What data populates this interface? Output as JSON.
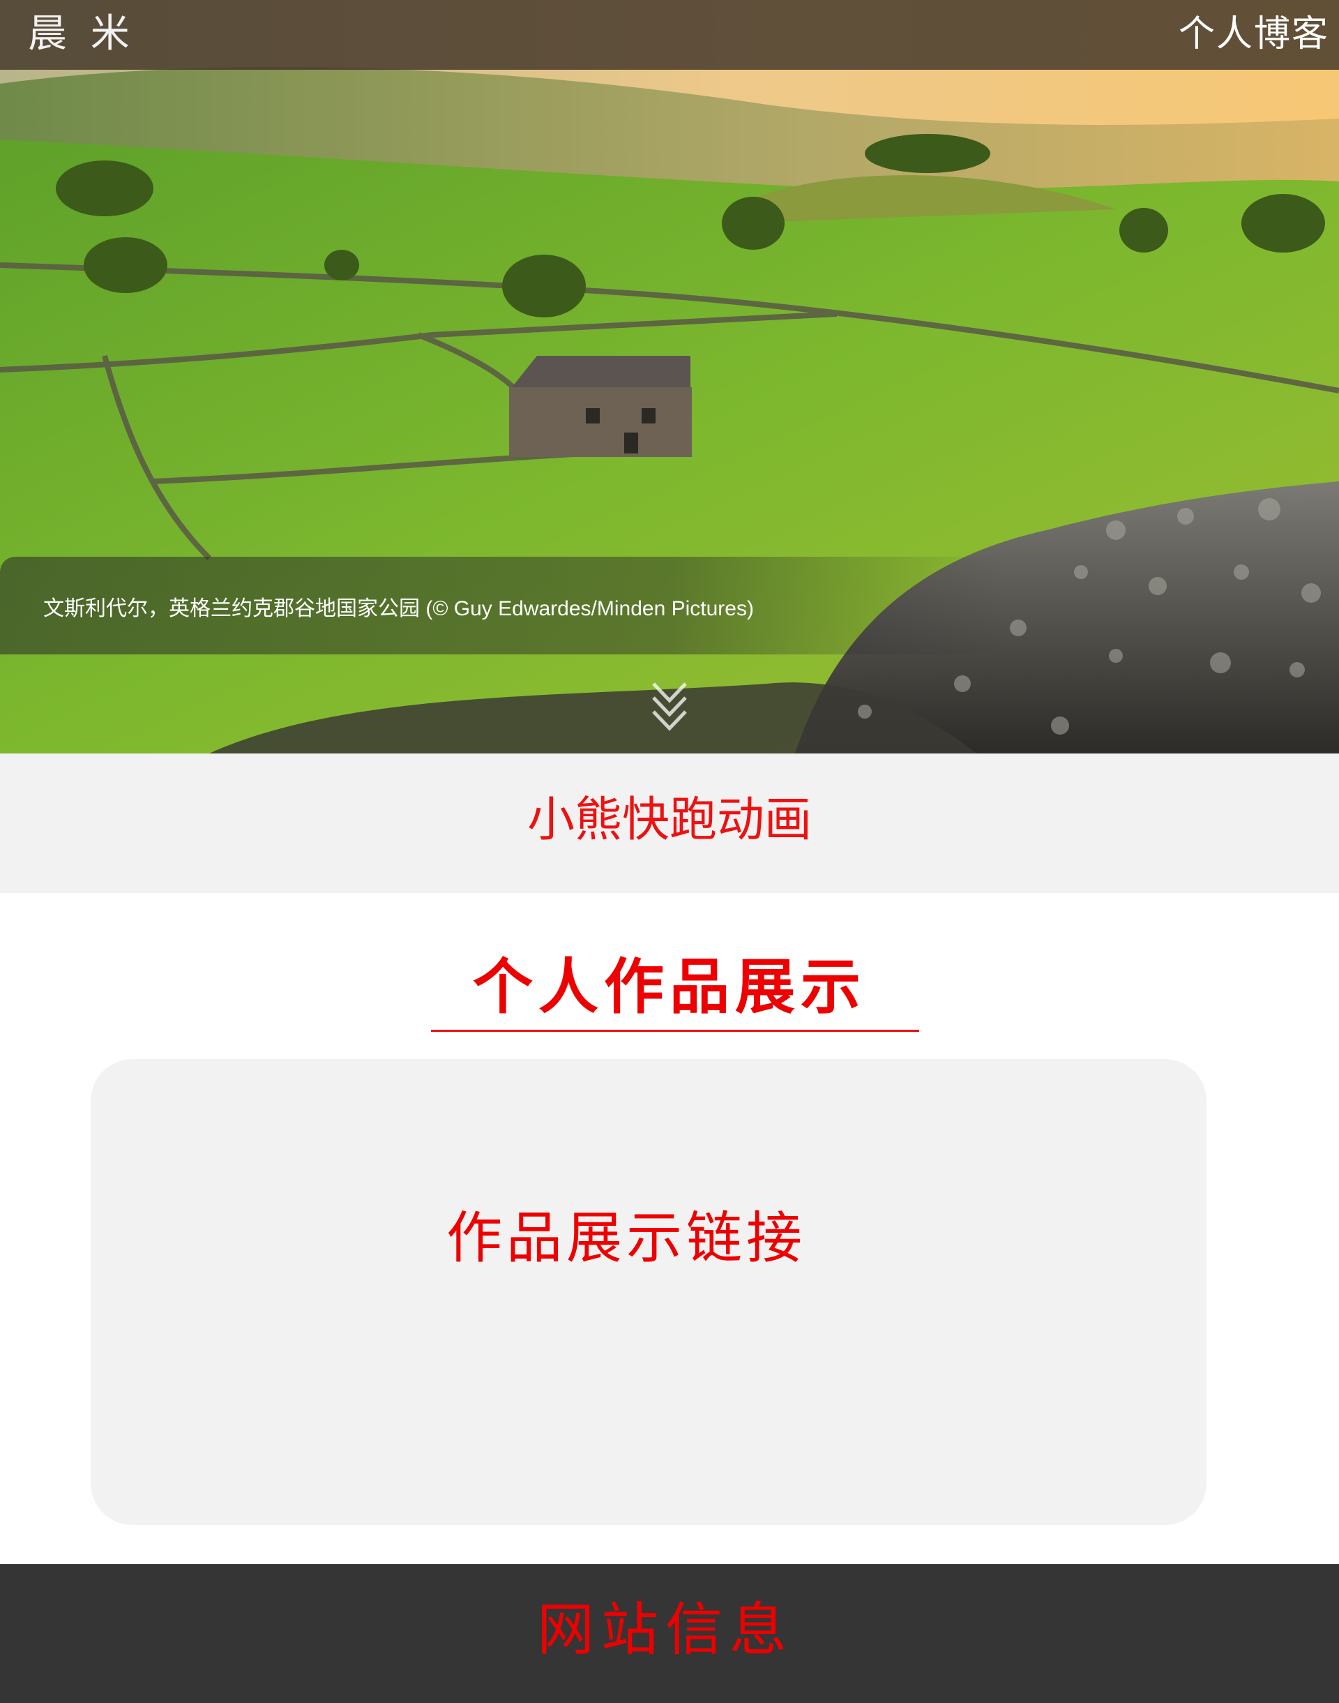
{
  "header": {
    "brand": "晨 米",
    "blog_link": "个人博客"
  },
  "hero": {
    "caption": "文斯利代尔，英格兰约克郡谷地国家公园 (© Guy Edwardes/Minden Pictures)",
    "scroll_icon": "double-chevron-down-icon"
  },
  "animation_section": {
    "title": "小熊快跑动画"
  },
  "works": {
    "heading": "个人作品展示",
    "link_label": "作品展示链接"
  },
  "footer": {
    "title": "网站信息"
  },
  "colors": {
    "accent_red": "#ee0000",
    "topbar": "#463a2c",
    "light_gray": "#f2f2f2",
    "footer_bg": "#353535"
  }
}
